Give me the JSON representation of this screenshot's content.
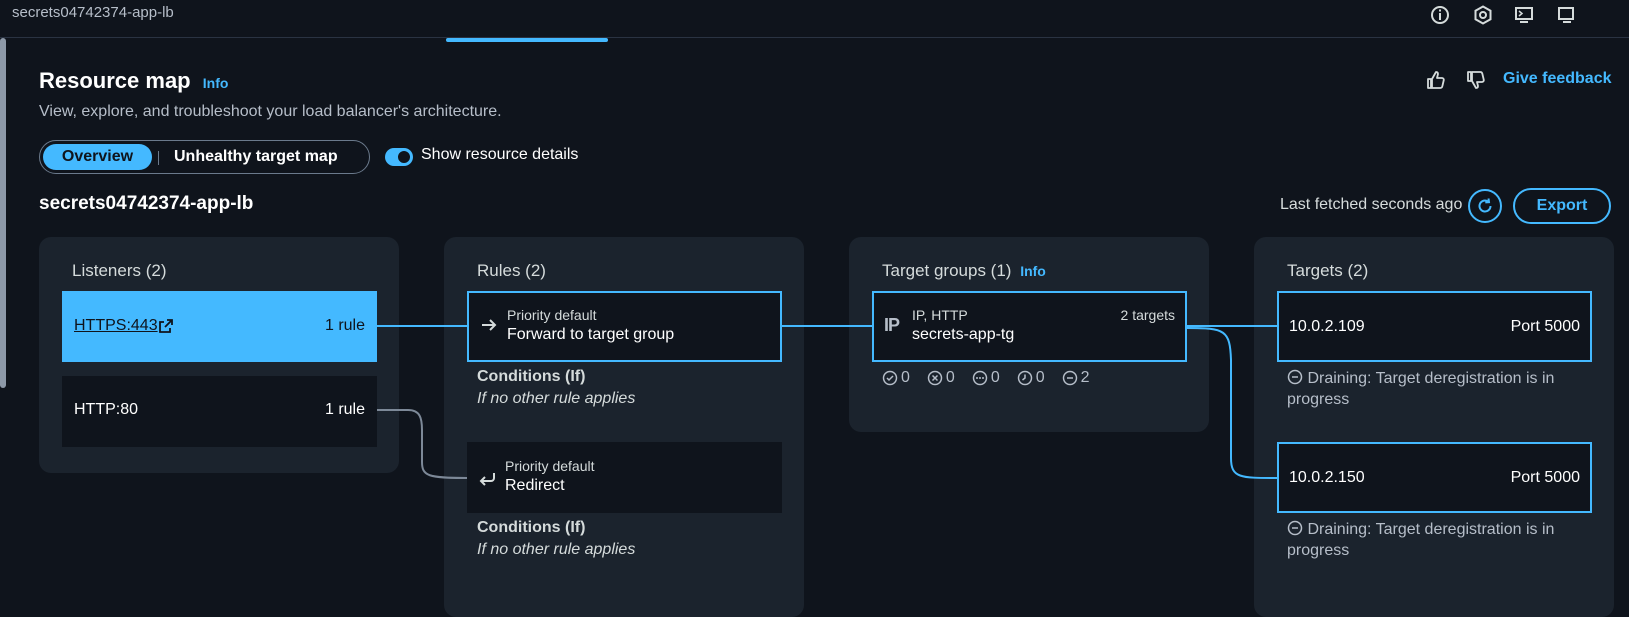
{
  "topbar": {
    "title": "secrets04742374-app-lb",
    "icons": [
      "info-icon",
      "settings-hex-icon",
      "cloudshell-icon",
      "expand-icon"
    ]
  },
  "header": {
    "title": "Resource map",
    "info": "Info",
    "subtitle": "View, explore, and troubleshoot your load balancer's architecture.",
    "feedback": "Give feedback"
  },
  "tabs": {
    "overview": "Overview",
    "unhealthy": "Unhealthy target map"
  },
  "toggle": {
    "label": "Show resource details",
    "checked": true
  },
  "map": {
    "lb_name": "secrets04742374-app-lb",
    "last_fetched": "Last fetched seconds ago",
    "export": "Export"
  },
  "listeners": {
    "title": "Listeners (2)",
    "items": [
      {
        "label": "HTTPS:443",
        "rules": "1 rule"
      },
      {
        "label": "HTTP:80",
        "rules": "1 rule"
      }
    ]
  },
  "rules": {
    "title": "Rules (2)",
    "items": [
      {
        "priority": "Priority default",
        "action": "Forward to target group",
        "cond_title": "Conditions (If)",
        "cond_text": "If no other rule applies"
      },
      {
        "priority": "Priority default",
        "action": "Redirect",
        "cond_title": "Conditions (If)",
        "cond_text": "If no other rule applies"
      }
    ]
  },
  "target_groups": {
    "title": "Target groups (1)",
    "info": "Info",
    "item": {
      "protocol": "IP, HTTP",
      "name": "secrets-app-tg",
      "count": "2 targets",
      "status_counts": [
        "0",
        "0",
        "0",
        "0",
        "2"
      ]
    }
  },
  "targets": {
    "title": "Targets (2)",
    "items": [
      {
        "ip": "10.0.2.109",
        "port": "Port 5000",
        "status": "Draining: Target deregistration is in progress"
      },
      {
        "ip": "10.0.2.150",
        "port": "Port 5000",
        "status": "Draining: Target deregistration is in progress"
      }
    ]
  },
  "colors": {
    "accent": "#44b9ff",
    "background": "#0f141c",
    "panel": "#1b232d"
  }
}
